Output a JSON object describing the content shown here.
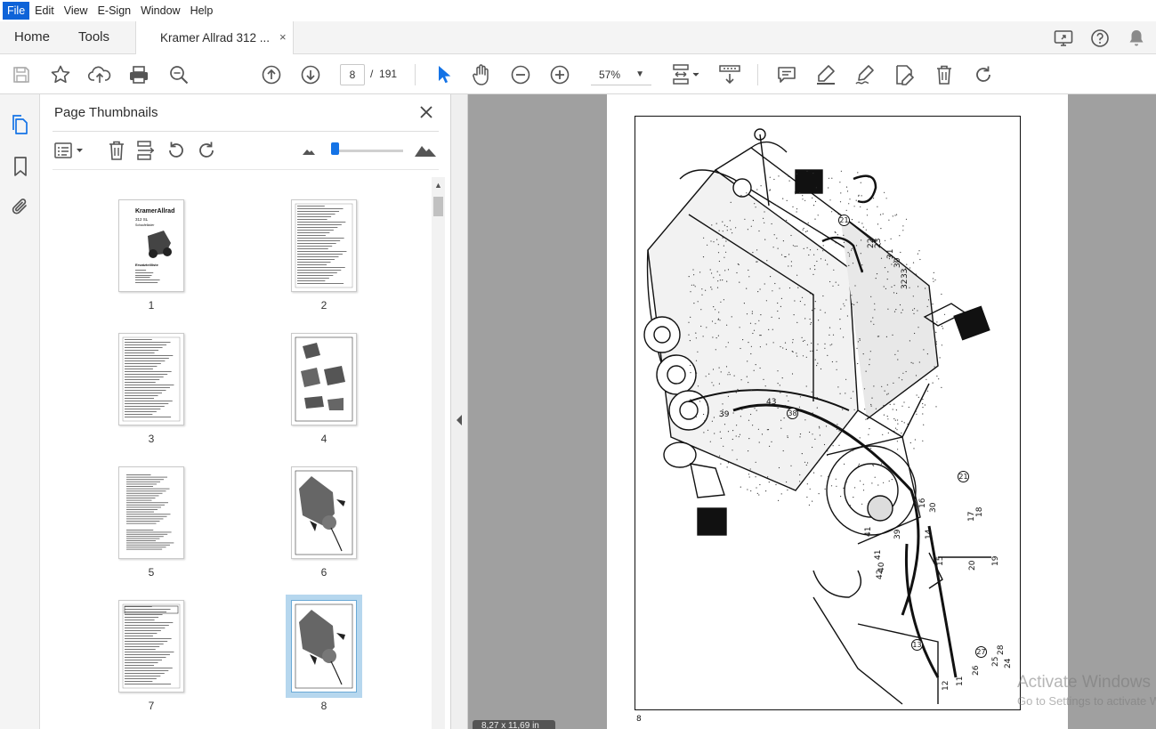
{
  "menu": [
    "File",
    "Edit",
    "View",
    "E-Sign",
    "Window",
    "Help"
  ],
  "tabs": {
    "home": "Home",
    "tools": "Tools",
    "document": "Kramer Allrad 312 ...",
    "close": "×"
  },
  "toolbar": {
    "current_page": "8",
    "page_separator": "/",
    "total_pages": "191",
    "zoom": "57%"
  },
  "panel": {
    "title": "Page Thumbnails",
    "close": "×",
    "thumbnails": [
      {
        "label": "1",
        "kind": "cover",
        "selected": false
      },
      {
        "label": "2",
        "kind": "list",
        "selected": false
      },
      {
        "label": "3",
        "kind": "list",
        "selected": false
      },
      {
        "label": "4",
        "kind": "drawing-small",
        "selected": false
      },
      {
        "label": "5",
        "kind": "text",
        "selected": false
      },
      {
        "label": "6",
        "kind": "drawing",
        "selected": false
      },
      {
        "label": "7",
        "kind": "table",
        "selected": false
      },
      {
        "label": "8",
        "kind": "drawing",
        "selected": true
      }
    ],
    "thumb1_brand": "KramerAllrad",
    "thumb1_model": "312 SL",
    "thumb1_sub": "Schaufellader",
    "thumb1_title": "Ersatzteilliste"
  },
  "document": {
    "page_number": "8",
    "part_labels": [
      "21",
      "22",
      "23",
      "31",
      "30",
      "33",
      "32",
      "41",
      "43",
      "38",
      "39",
      "21",
      "16",
      "15",
      "30",
      "17",
      "18",
      "20",
      "19",
      "14",
      "42",
      "41",
      "40",
      "39",
      "12",
      "13",
      "27",
      "28",
      "25",
      "24",
      "26",
      "11"
    ],
    "page_size": "8,27 x 11,69 in"
  },
  "watermark": {
    "line1": "Activate Windows",
    "line2": "Go to Settings to activate Windows."
  },
  "colors": {
    "accent": "#1473e6",
    "menu_active": "#0e63d8",
    "canvas": "#a0a0a0",
    "selection": "#b6d7ee"
  }
}
